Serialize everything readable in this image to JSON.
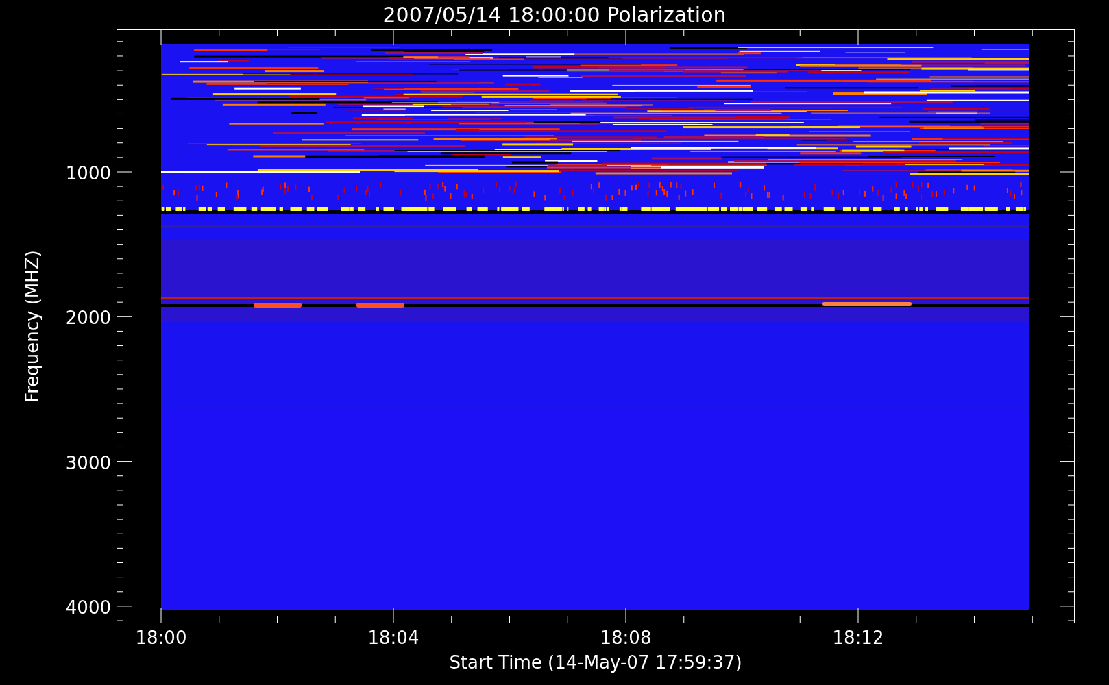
{
  "plot": {
    "title": "2007/05/14 18:00:00 Polarization",
    "xlabel": "Start Time (14-May-07 17:59:37)",
    "ylabel": "Frequency (MHZ)",
    "xticks": [
      "18:00",
      "18:04",
      "18:08",
      "18:12"
    ],
    "yticks": [
      "1000",
      "2000",
      "3000",
      "4000"
    ]
  }
}
